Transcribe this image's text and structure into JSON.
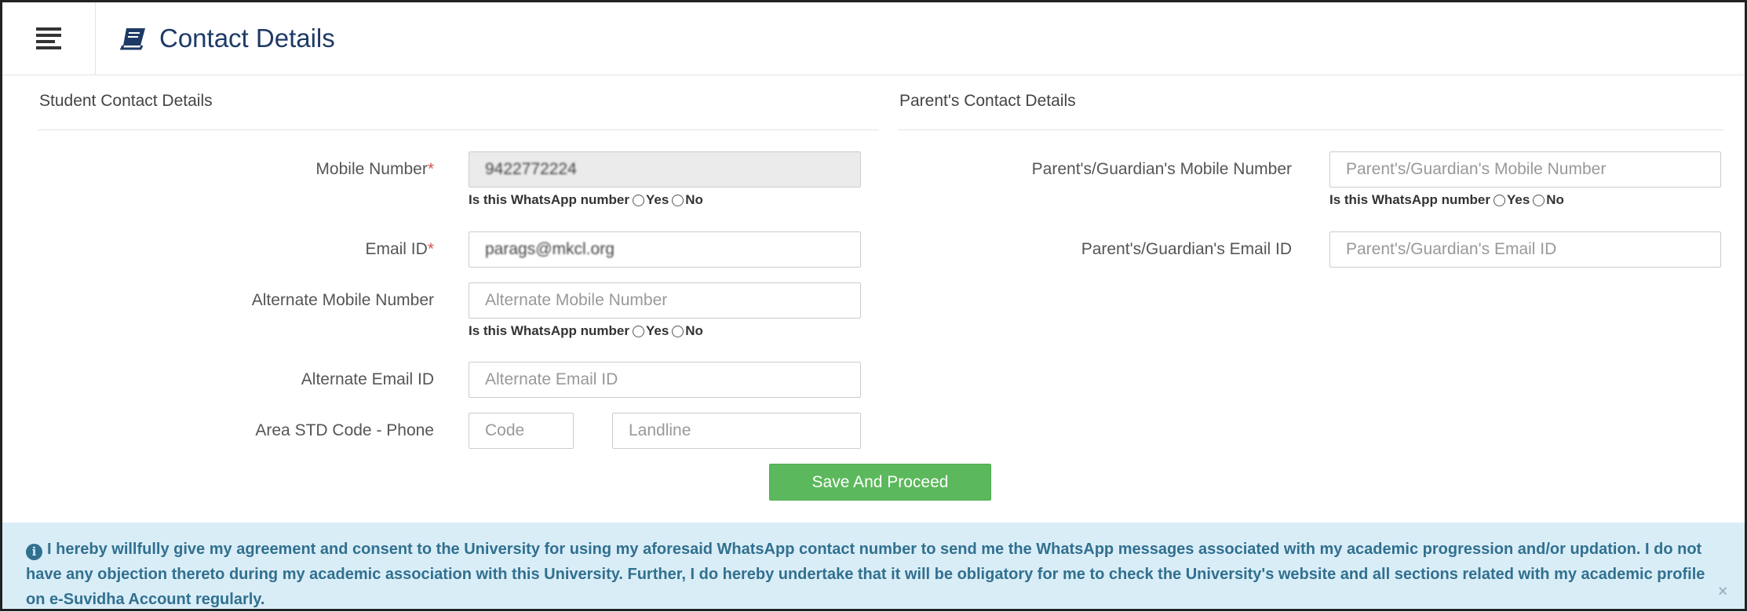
{
  "header": {
    "title": "Contact Details",
    "menu_icon": "hamburger-icon",
    "title_icon": "book-icon"
  },
  "student": {
    "section_title": "Student Contact Details",
    "mobile_label": "Mobile Number",
    "mobile_value": "9422772224",
    "email_label": "Email ID",
    "email_value": "parags@mkcl.org",
    "alt_mobile_label": "Alternate Mobile Number",
    "alt_mobile_placeholder": "Alternate Mobile Number",
    "alt_email_label": "Alternate Email ID",
    "alt_email_placeholder": "Alternate Email ID",
    "std_label": "Area STD Code - Phone",
    "code_placeholder": "Code",
    "landline_placeholder": "Landline",
    "required_mark": "*"
  },
  "parent": {
    "section_title": "Parent's Contact Details",
    "mobile_label": "Parent's/Guardian's Mobile Number",
    "mobile_placeholder": "Parent's/Guardian's Mobile Number",
    "email_label": "Parent's/Guardian's Email ID",
    "email_placeholder": "Parent's/Guardian's Email ID"
  },
  "whatsapp": {
    "question": "Is this WhatsApp number",
    "yes": "Yes",
    "no": "No"
  },
  "save_button": "Save And Proceed",
  "notice": {
    "text": "I hereby willfully give my agreement and consent to the University for using my aforesaid WhatsApp contact number to send me the WhatsApp messages associated with my academic progression and/or updation. I do not have any objection thereto during my academic association with this University. Further, I do hereby undertake that it will be obligatory for me to check the University's website and all sections related with my academic profile on e-Suvidha Account regularly.",
    "close": "×"
  },
  "colors": {
    "title": "#1e3a66",
    "save_button": "#5cb85c",
    "notice_bg": "#d9edf7",
    "notice_text": "#31708f",
    "required": "#d9534f"
  }
}
